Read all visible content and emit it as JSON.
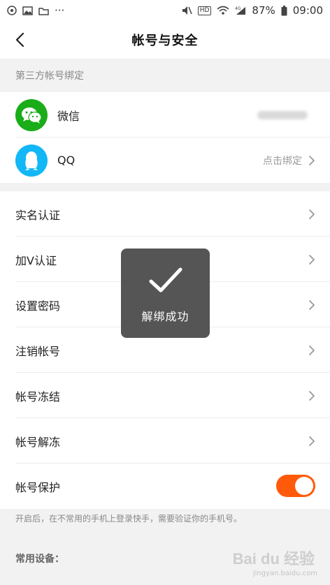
{
  "status_bar": {
    "left_icons": [
      "vpn-icon",
      "image-icon",
      "folder-icon",
      "more-dots-icon"
    ],
    "more": "···",
    "hd": "HD",
    "network": "4G",
    "battery_percent": "87%",
    "time": "09:00"
  },
  "nav": {
    "title": "帐号与安全"
  },
  "third_party": {
    "section_title": "第三方帐号绑定",
    "items": [
      {
        "label": "微信",
        "icon": "wechat-icon",
        "color": "#1aad19",
        "status": ""
      },
      {
        "label": "QQ",
        "icon": "qq-penguin-icon",
        "color": "#12b7f5",
        "status": "点击绑定"
      }
    ]
  },
  "menu": {
    "items": [
      {
        "label": "实名认证"
      },
      {
        "label": "加V认证"
      },
      {
        "label": "设置密码"
      },
      {
        "label": "注销帐号"
      },
      {
        "label": "帐号冻结"
      },
      {
        "label": "帐号解冻"
      }
    ],
    "protection": {
      "label": "帐号保护",
      "enabled": true,
      "accent": "#ff5a0a"
    }
  },
  "protection_hint": "开启后，在不常用的手机上登录快手，需要验证你的手机号。",
  "devices_title": "常用设备：",
  "toast": {
    "text": "解绑成功"
  },
  "watermark": {
    "brand": "Bai du 经验",
    "sub": "jingyan.baidu.com"
  }
}
